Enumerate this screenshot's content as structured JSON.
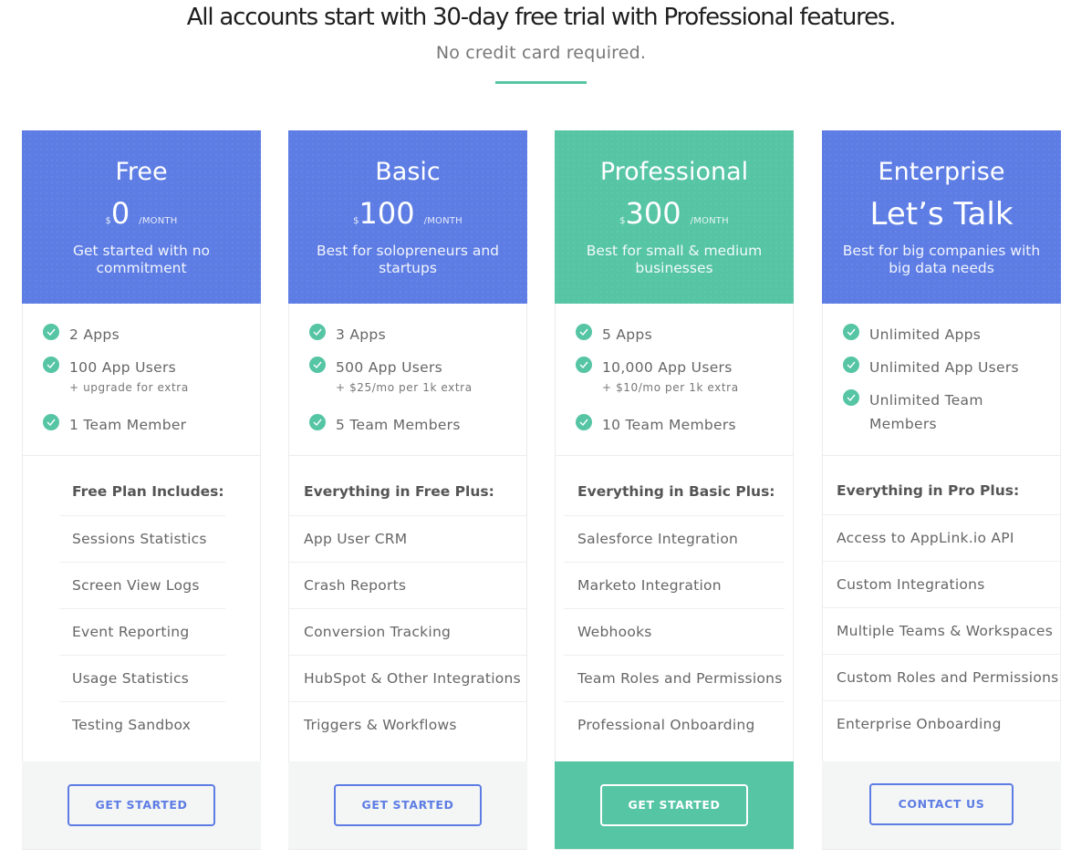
{
  "header": {
    "title": "All accounts start with 30-day free trial with Professional features.",
    "subtitle": "No credit card required."
  },
  "colors": {
    "primary": "#5d7de4",
    "accent": "#56c5a4",
    "footer_bg": "#f4f5f5"
  },
  "plans": [
    {
      "name": "Free",
      "currency": "$",
      "price": "0",
      "period": "/MONTH",
      "tagline": "Get started with no commitment",
      "limits": [
        {
          "icon": "check-circle-icon",
          "text": "2 Apps"
        },
        {
          "icon": "check-circle-icon",
          "text": "100 App Users",
          "note": "+ upgrade for extra"
        },
        {
          "icon": "check-circle-icon",
          "text": "1 Team Member"
        }
      ],
      "features_title": "Free Plan Includes:",
      "features": [
        "Sessions Statistics",
        "Screen View Logs",
        "Event Reporting",
        "Usage Statistics",
        "Testing Sandbox"
      ],
      "cta": "GET STARTED"
    },
    {
      "name": "Basic",
      "currency": "$",
      "price": "100",
      "period": "/MONTH",
      "tagline": "Best for solopreneurs and startups",
      "limits": [
        {
          "icon": "check-circle-icon",
          "text": "3 Apps"
        },
        {
          "icon": "check-circle-icon",
          "text": "500 App Users",
          "note": "+ $25/mo per 1k extra"
        },
        {
          "icon": "check-circle-icon",
          "text": "5 Team Members"
        }
      ],
      "features_title": "Everything in Free Plus:",
      "features": [
        "App User CRM",
        "Crash Reports",
        "Conversion Tracking",
        "HubSpot & Other Integrations",
        "Triggers & Workflows"
      ],
      "cta": "GET STARTED"
    },
    {
      "name": "Professional",
      "currency": "$",
      "price": "300",
      "period": "/MONTH",
      "tagline": "Best for small & medium businesses",
      "featured": true,
      "limits": [
        {
          "icon": "check-circle-icon",
          "text": "5 Apps"
        },
        {
          "icon": "check-circle-icon",
          "text": "10,000 App Users",
          "note": "+ $10/mo per 1k extra"
        },
        {
          "icon": "check-circle-icon",
          "text": "10 Team Members"
        }
      ],
      "features_title": "Everything in Basic Plus:",
      "features": [
        "Salesforce Integration",
        "Marketo Integration",
        "Webhooks",
        "Team Roles and Permissions",
        "Professional Onboarding"
      ],
      "cta": "GET STARTED"
    },
    {
      "name": "Enterprise",
      "price_text": "Let’s Talk",
      "tagline": "Best for big companies with big data needs",
      "limits": [
        {
          "icon": "check-circle-icon",
          "text": "Unlimited Apps"
        },
        {
          "icon": "check-circle-icon",
          "text": "Unlimited App Users"
        },
        {
          "icon": "check-circle-icon",
          "text": "Unlimited Team",
          "text2": "Members"
        }
      ],
      "features_title": "Everything in Pro Plus:",
      "features": [
        "Access to AppLink.io API",
        "Custom Integrations",
        "Multiple Teams & Workspaces",
        "Custom Roles and Permissions",
        "Enterprise Onboarding"
      ],
      "cta": "CONTACT US"
    }
  ]
}
